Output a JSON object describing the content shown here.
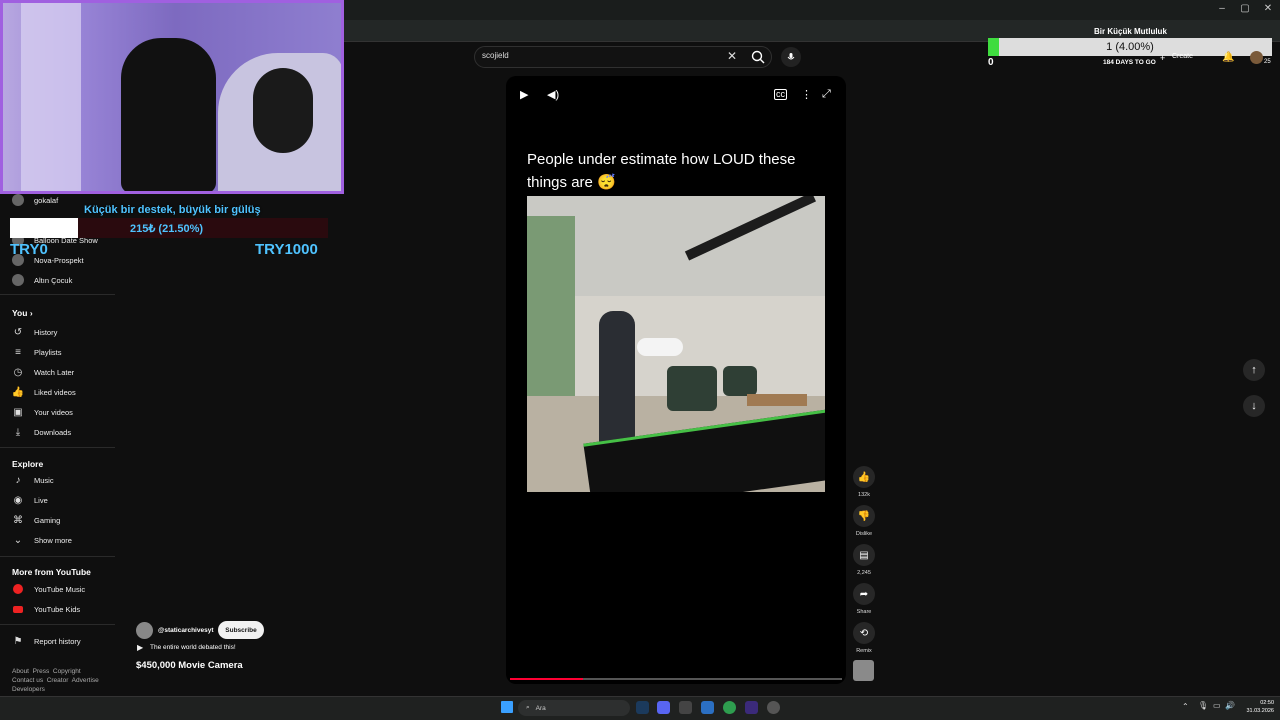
{
  "window": {
    "controls": [
      "–",
      "▢",
      "✕"
    ]
  },
  "search": {
    "query": "scojield",
    "clear_icon": "✕"
  },
  "sidebar": {
    "subscriptions": [
      {
        "label": "gokalaf"
      },
      {
        "label": "Balloon Date Show"
      },
      {
        "label": "Nova-Prospekt"
      },
      {
        "label": "Altın Çocuk"
      }
    ],
    "you_header": "You",
    "you_items": [
      {
        "label": "History",
        "icon": "history-icon"
      },
      {
        "label": "Playlists",
        "icon": "playlists-icon"
      },
      {
        "label": "Watch Later",
        "icon": "clock-icon"
      },
      {
        "label": "Liked videos",
        "icon": "thumb-up-icon"
      },
      {
        "label": "Your videos",
        "icon": "play-square-icon"
      },
      {
        "label": "Downloads",
        "icon": "download-icon"
      }
    ],
    "explore_header": "Explore",
    "explore_items": [
      {
        "label": "Music",
        "icon": "music-icon"
      },
      {
        "label": "Live",
        "icon": "live-icon"
      },
      {
        "label": "Gaming",
        "icon": "gaming-icon"
      },
      {
        "label": "Show more",
        "icon": "chevron-down-icon"
      }
    ],
    "more_header": "More from YouTube",
    "more_items": [
      {
        "label": "YouTube Music"
      },
      {
        "label": "YouTube Kids"
      }
    ],
    "report": "Report history",
    "footer": [
      "About",
      "Press",
      "Copyright",
      "Contact us",
      "Creator",
      "Advertise",
      "Developers"
    ]
  },
  "donation": {
    "message": "Küçük bir destek, büyük bir gülüş",
    "amount": "215₺ (21.50%)",
    "progress": 0.215,
    "min": "TRY0",
    "max": "TRY1000"
  },
  "goal": {
    "title": "Bir Küçük Mutluluk",
    "value": "1 (4.00%)",
    "progress": 0.04,
    "start": "0",
    "days": "184 DAYS TO GO"
  },
  "topbar": {
    "create": "Create",
    "notifications": "25"
  },
  "short": {
    "caption": "People under estimate how LOUD these things are 😴",
    "progress": 0.22,
    "actions": [
      {
        "icon": "thumb-up-icon",
        "label": "132k"
      },
      {
        "icon": "thumb-down-icon",
        "label": "Dislike"
      },
      {
        "icon": "comment-icon",
        "label": "2,245"
      },
      {
        "icon": "share-icon",
        "label": "Share"
      },
      {
        "icon": "remix-icon",
        "label": "Remix"
      }
    ],
    "channel": "@staticarchivesyt",
    "subscribe": "Subscribe",
    "description": "The entire world debated this!",
    "title": "$450,000 Movie Camera"
  },
  "taskbar": {
    "search": "Ara",
    "time": "02:50",
    "date": "31.03.2026"
  }
}
